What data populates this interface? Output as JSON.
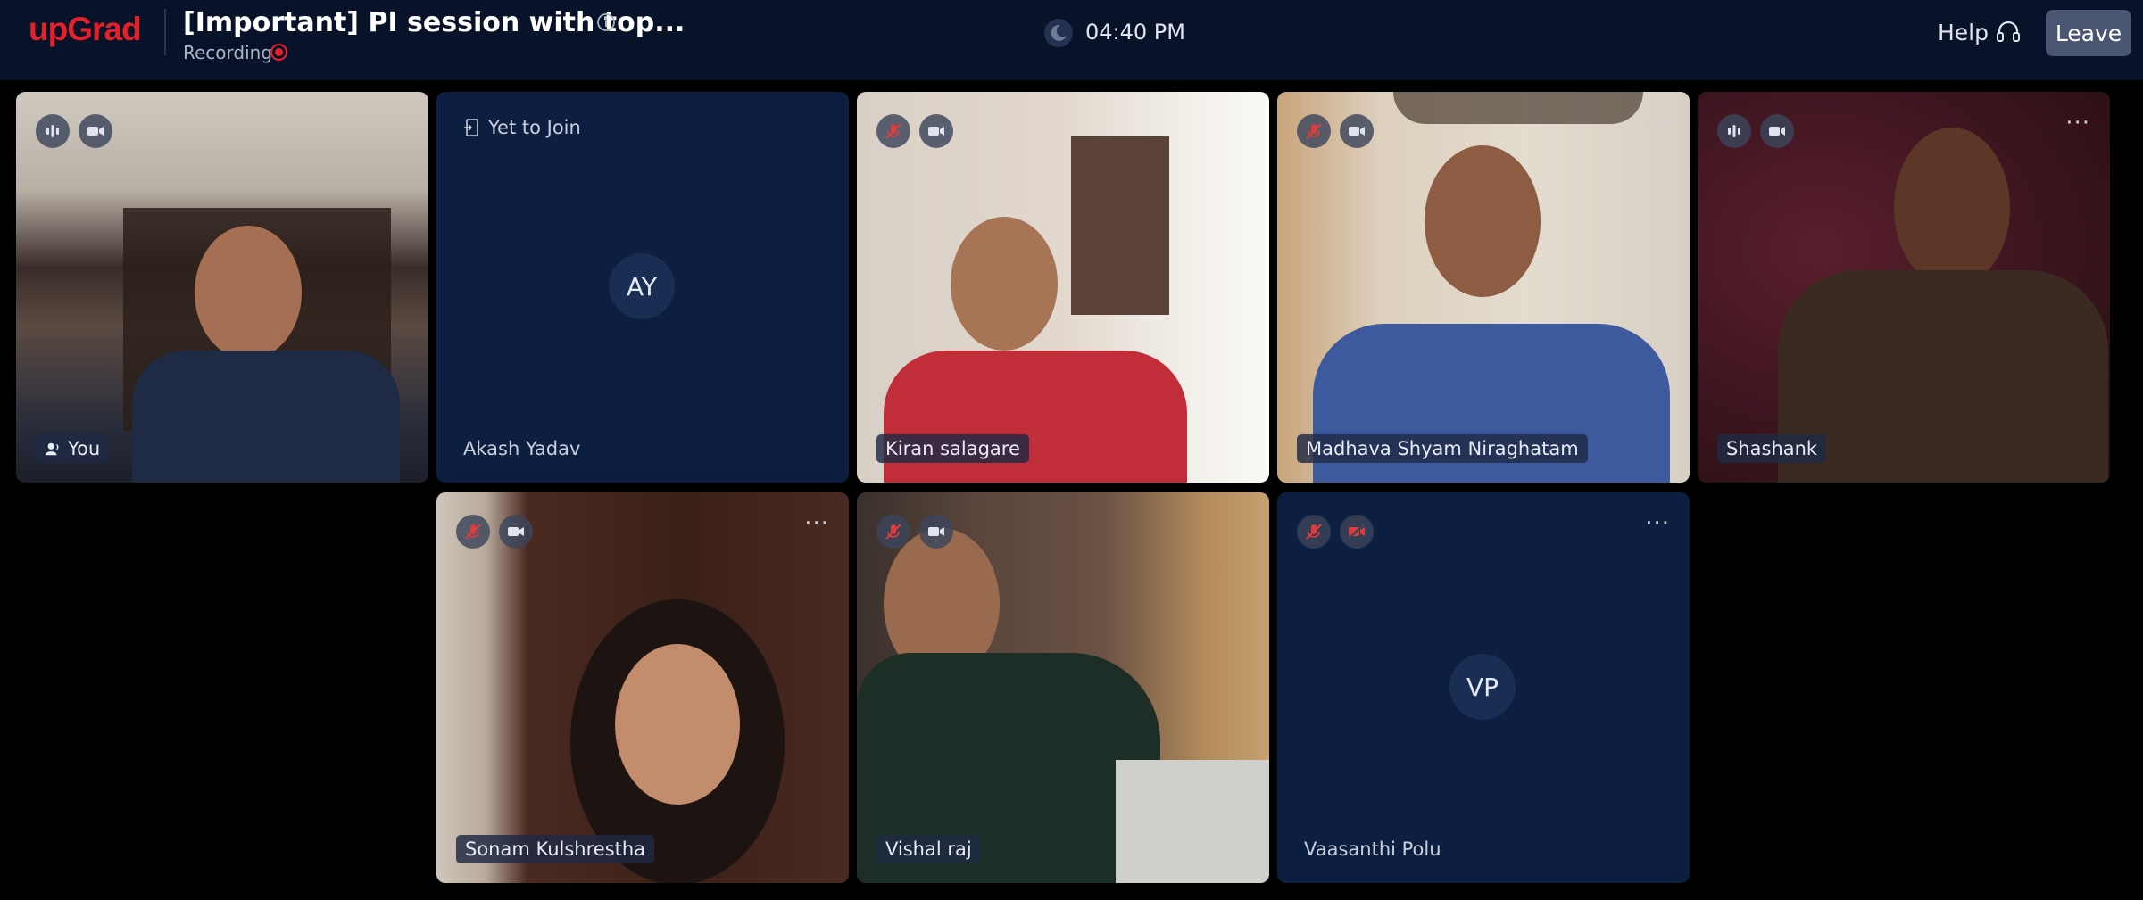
{
  "header": {
    "logo": "upGrad",
    "meeting_title": "[Important] PI session with top...",
    "recording_label": "Recording",
    "time": "04:40 PM",
    "help_label": "Help",
    "leave_label": "Leave"
  },
  "colors": {
    "brand": "#e5202a",
    "background": "#000000",
    "topbar": "#081329",
    "tile": "#0d1f40",
    "muted_red": "#e33b3b"
  },
  "tiles": [
    {
      "name": "You",
      "state": "video",
      "mic": "on",
      "camera": "on"
    },
    {
      "name": "Akash Yadav",
      "state": "avatar",
      "initials": "AY",
      "status": "Yet to Join"
    },
    {
      "name": "Kiran salagare",
      "state": "video",
      "mic": "muted",
      "camera": "on"
    },
    {
      "name": "Madhava Shyam Niraghatam",
      "state": "video",
      "mic": "muted",
      "camera": "on"
    },
    {
      "name": "Shashank",
      "state": "video",
      "mic": "on",
      "camera": "on"
    },
    {
      "name": "Sonam Kulshrestha",
      "state": "video",
      "mic": "muted",
      "camera": "on"
    },
    {
      "name": "Vishal raj",
      "state": "video",
      "mic": "muted",
      "camera": "on"
    },
    {
      "name": "Vaasanthi Polu",
      "state": "avatar",
      "initials": "VP",
      "mic": "muted",
      "camera": "off"
    }
  ],
  "icons": {
    "info": "info-icon",
    "recording": "record-dot-icon",
    "clock": "clock-icon",
    "help": "headset-icon",
    "mic_on": "audio-level-icon",
    "mic_muted": "mic-muted-icon",
    "camera_on": "video-camera-icon",
    "camera_off": "video-off-icon",
    "more": "more-options-icon",
    "speaker": "speaking-user-icon",
    "yet_to_join": "door-enter-icon"
  }
}
